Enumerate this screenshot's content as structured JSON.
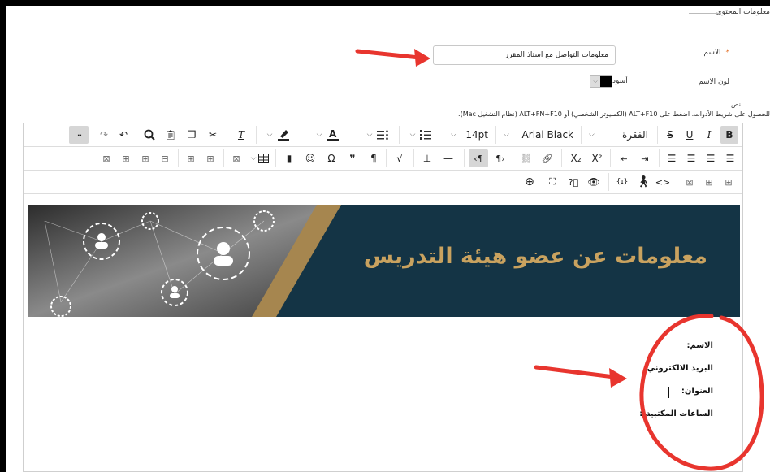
{
  "section_title": "معلومات المحتوى",
  "form": {
    "name_label": "الاسم",
    "name_value": "معلومات التواصل مع أستاذ المقرر",
    "color_label": "لون الاسم",
    "color_value": "أسود",
    "color_hex": "#000000",
    "text_label": "نص",
    "help_text": "للحصول على شريط الأدوات، اضغط على ALT+F10 (الكمبيوتر الشخصي) أو ALT+FN+F10 (نظام التشغيل Mac)."
  },
  "toolbar": {
    "row1": {
      "bold": "B",
      "italic": "I",
      "underline": "U",
      "strike": "S",
      "block_format": "الفقرة",
      "font_family": "Arial Black",
      "font_size": "14pt",
      "more": "···"
    },
    "row2": {
      "superscript": "X²",
      "subscript": "X₂",
      "paragraph_mark": "¶"
    },
    "row3": {
      "source_code": "<>",
      "variables": "{ɪ}"
    }
  },
  "banner": {
    "title": "معلومات عن عضو هيئة التدريس",
    "dark_color": "#143445",
    "accent_color": "#a6864f"
  },
  "content": {
    "name_line": "الاسم:",
    "email_line": "البريد الالكتروني:",
    "address_line": "العنوان:",
    "office_hours_line": "الساعات المكتبية :"
  },
  "annotations": {
    "color": "#e8352e"
  }
}
